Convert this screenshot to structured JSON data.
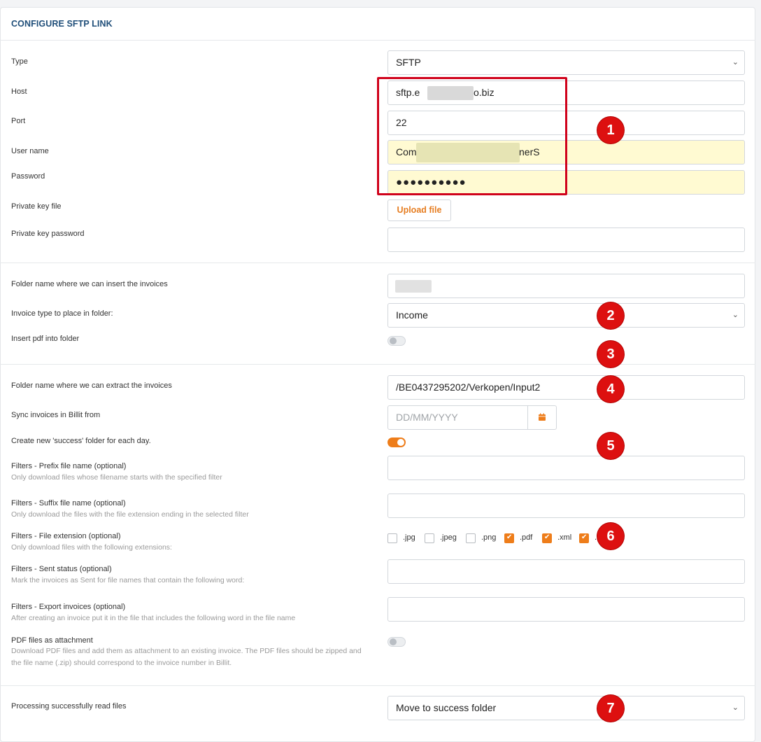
{
  "title": "CONFIGURE SFTP LINK",
  "connection": {
    "type_label": "Type",
    "type_value": "SFTP",
    "host_label": "Host",
    "host_value_start": "sftp.e",
    "host_value_end": "o.biz",
    "port_label": "Port",
    "port_value": "22",
    "username_label": "User name",
    "username_value_start": "Com",
    "username_value_end": "nerS",
    "password_label": "Password",
    "password_value": "●●●●●●●●●●",
    "private_key_label": "Private key file",
    "upload_label": "Upload file",
    "private_key_password_label": "Private key password"
  },
  "insert": {
    "folder_label": "Folder name where we can insert the invoices",
    "invoice_type_label": "Invoice type to place in folder:",
    "invoice_type_value": "Income",
    "insert_pdf_label": "Insert pdf into folder"
  },
  "extract": {
    "folder_label": "Folder name where we can extract the invoices",
    "folder_value": "/BE0437295202/Verkopen/Input2",
    "sync_label": "Sync invoices in Billit from",
    "sync_placeholder": "DD/MM/YYYY",
    "success_folder_label": "Create new 'success' folder for each day.",
    "prefix_label": "Filters - Prefix file name (optional)",
    "prefix_sub": "Only download files whose filename starts with the specified filter",
    "suffix_label": "Filters - Suffix file name (optional)",
    "suffix_sub": "Only download the files with the file extension ending in the selected filter",
    "extension_label": "Filters - File extension (optional)",
    "extension_sub": "Only download files with the following extensions:",
    "extensions": [
      {
        "label": ".jpg",
        "checked": false
      },
      {
        "label": ".jpeg",
        "checked": false
      },
      {
        "label": ".png",
        "checked": false
      },
      {
        "label": ".pdf",
        "checked": true
      },
      {
        "label": ".xml",
        "checked": true
      },
      {
        "label": ".",
        "checked": true
      }
    ],
    "sent_label": "Filters - Sent status (optional)",
    "sent_sub": "Mark the invoices as Sent for file names that contain the following word:",
    "export_label": "Filters - Export invoices (optional)",
    "export_sub": "After creating an invoice put it in the file that includes the following word in the file name",
    "pdf_attach_label": "PDF files as attachment",
    "pdf_attach_sub": "Download PDF files and add them as attachment to an existing invoice. The PDF files should be zipped and the file name (.zip) should correspond to the invoice number in Billit."
  },
  "processing": {
    "label": "Processing successfully read files",
    "value": "Move to success folder"
  },
  "badges": [
    "1",
    "2",
    "3",
    "4",
    "5",
    "6",
    "7"
  ],
  "colors": {
    "accent": "#ee7d1a",
    "title": "#1f4e79",
    "annotation_red": "#dd1010",
    "highlight_yellow": "#fffad2"
  }
}
